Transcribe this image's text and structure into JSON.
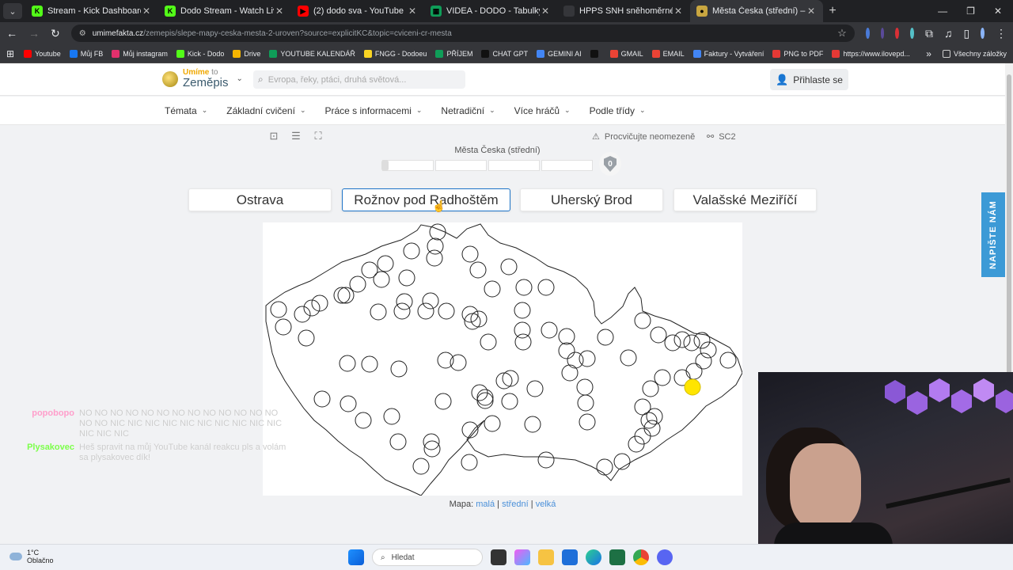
{
  "browser": {
    "tabs": [
      {
        "title": "Stream - Kick Dashboard",
        "fav": "K",
        "color": "#53fc18",
        "active": false
      },
      {
        "title": "Dodo Stream - Watch Live on K",
        "fav": "K",
        "color": "#53fc18",
        "active": false
      },
      {
        "title": "(2) dodo sva - YouTube",
        "fav": "▶",
        "color": "#ff0000",
        "active": false
      },
      {
        "title": "VIDEA - DODO - Tabulky Googl",
        "fav": "▦",
        "color": "#0f9d58",
        "active": false
      },
      {
        "title": "HPPS SNH sněhoměrné stanice",
        "fav": "",
        "color": "#35363a",
        "active": false
      },
      {
        "title": "Města Česka (střední) – Slepé m",
        "fav": "●",
        "color": "#c9a640",
        "active": true
      }
    ],
    "new_tab": "+",
    "url_host": "umimefakta.cz",
    "url_path": "/zemepis/slepe-mapy-ceska-mesta-2-uroven?source=explicitKC&topic=cviceni-cr-mesta",
    "bookmarks": [
      {
        "label": "Youtube",
        "color": "#ff0000"
      },
      {
        "label": "Můj FB",
        "color": "#1877f2"
      },
      {
        "label": "Můj instagram",
        "color": "#e1306c"
      },
      {
        "label": "Kick - Dodo",
        "color": "#53fc18"
      },
      {
        "label": "Drive",
        "color": "#f4b400"
      },
      {
        "label": "YOUTUBE KALENDÁŘ",
        "color": "#0f9d58"
      },
      {
        "label": "FNGG - Dodoeu",
        "color": "#f9d423"
      },
      {
        "label": "PŘÍJEM",
        "color": "#0f9d58"
      },
      {
        "label": "CHAT GPT",
        "color": "#111111"
      },
      {
        "label": "GEMINI AI",
        "color": "#4285f4"
      },
      {
        "label": "",
        "color": "#111111"
      },
      {
        "label": "GMAIL",
        "color": "#ea4335"
      },
      {
        "label": "EMAIL",
        "color": "#ea4335"
      },
      {
        "label": "Faktury - Vytváření",
        "color": "#4285f4"
      },
      {
        "label": "PNG to PDF",
        "color": "#e53935"
      },
      {
        "label": "https://www.ilovepd...",
        "color": "#e53935"
      }
    ],
    "bookmarks_more": "»",
    "all_bookmarks": "Všechny záložky"
  },
  "site": {
    "logo_top": "Umíme",
    "logo_to": "to",
    "logo_bottom": "Zeměpis",
    "search_placeholder": "Evropa, řeky, ptáci, druhá světová...",
    "login": "Přihlaste se",
    "menu": [
      "Témata",
      "Základní cvičení",
      "Práce s informacemi",
      "Netradiční",
      "Více hráčů",
      "Podle třídy"
    ],
    "practice_label": "Procvičujte neomezeně",
    "share_label": "SC2",
    "level_title": "Města Česka (střední)",
    "level_value": "0",
    "answers": [
      "Ostrava",
      "Rožnov pod Radhoštěm",
      "Uherský Brod",
      "Valašské Meziříčí"
    ],
    "map_label": "Mapa:",
    "map_small": "malá",
    "map_medium": "střední",
    "map_large": "velká",
    "sep": "|",
    "feedback": "NAPIŠTE NÁM"
  },
  "chat": [
    {
      "user": "popobopo",
      "color": "#ff9ecb",
      "msg": "NO NO NO NO NO NO NO NO NO NO NO NO NO NO NO NIC NIC NIC NIC NIC NIC NIC NIC NIC NIC NIC NIC NIC"
    },
    {
      "user": "Plysakovec",
      "color": "#7cff4a",
      "msg": "Heš spravit na můj YouTube kanál reakcu pls a volám sa plysakovec dík!"
    }
  ],
  "taskbar": {
    "temp": "1°C",
    "weather": "Oblačno",
    "search": "Hledat"
  },
  "colors": {
    "accent": "#1d74c8",
    "target_dot": "#ffe500",
    "feedback_bg": "#3c9ad6"
  }
}
